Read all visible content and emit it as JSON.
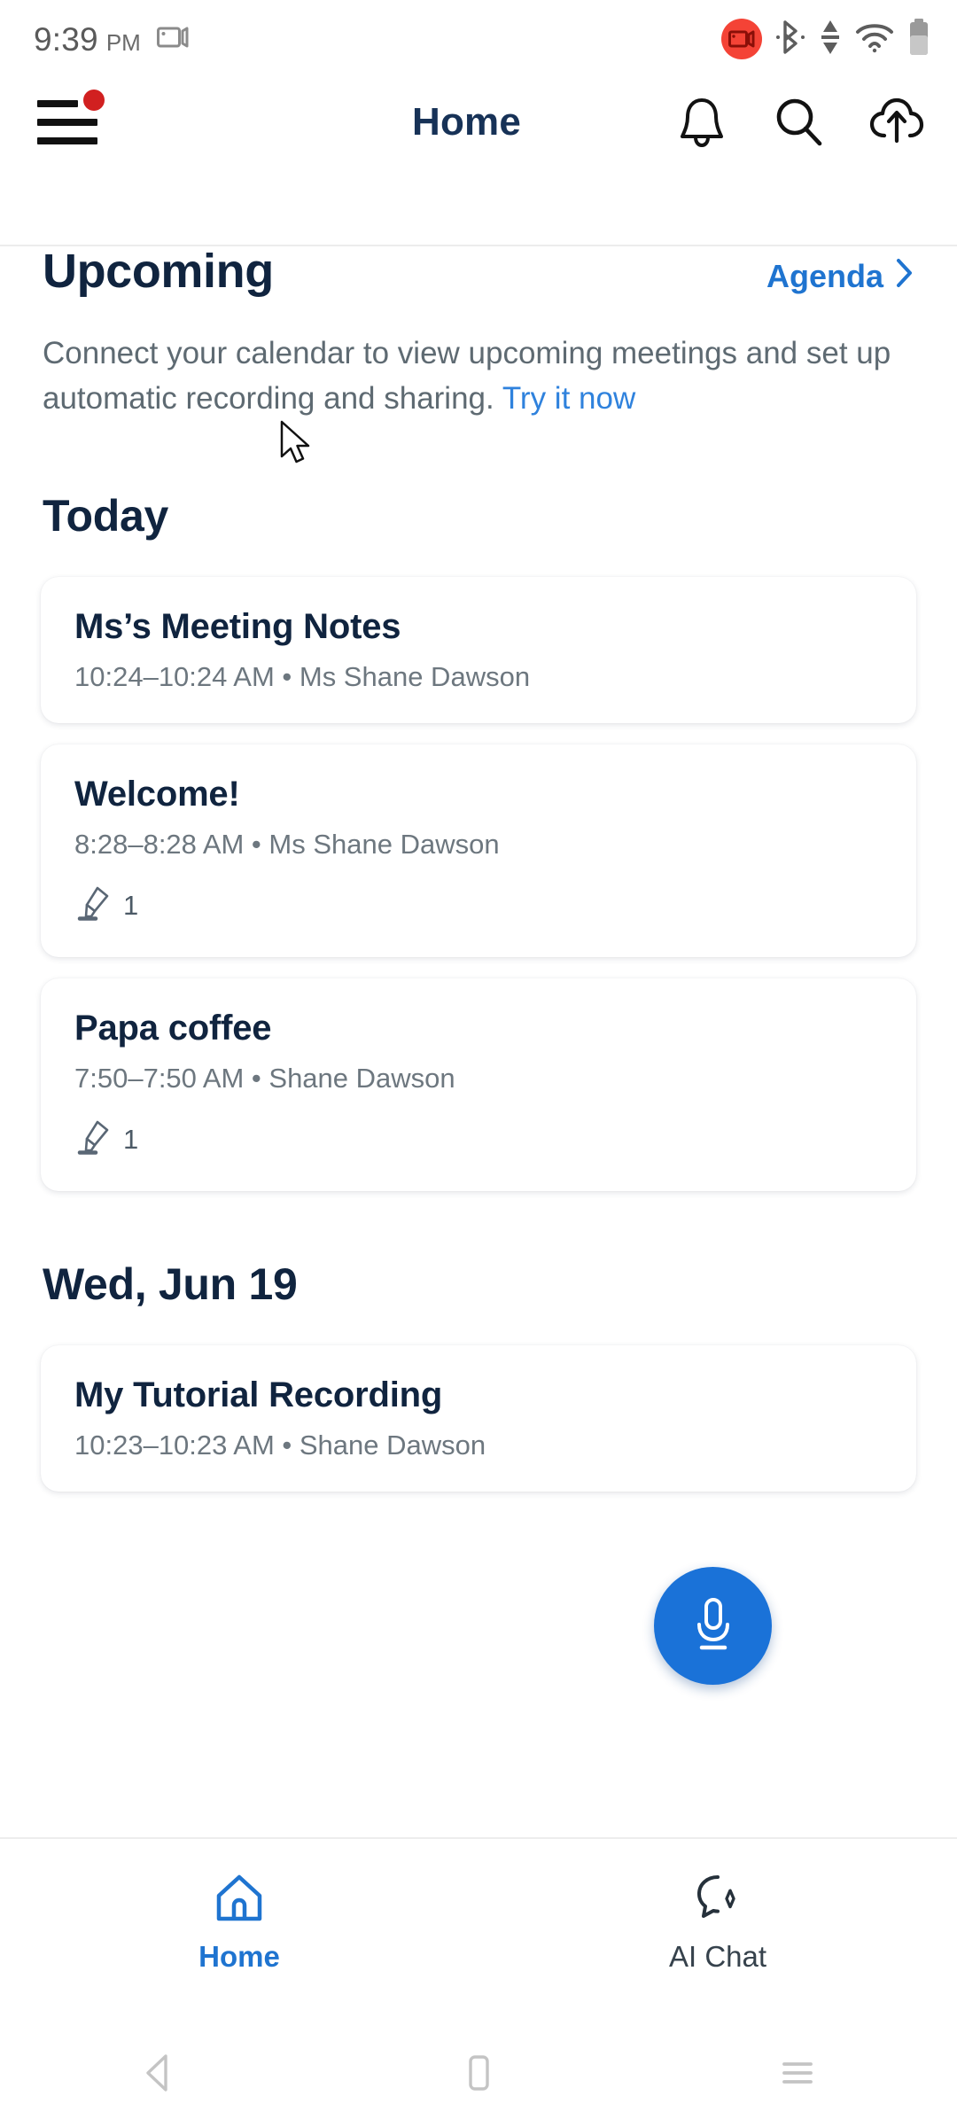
{
  "statusbar": {
    "time": "9:39",
    "ampm": "PM",
    "icons": [
      "screen-record-icon",
      "recording-badge-icon",
      "bluetooth-icon",
      "data-transfer-icon",
      "wifi-icon",
      "battery-icon"
    ]
  },
  "appbar": {
    "title": "Home",
    "menu_icon": "hamburger-menu-icon",
    "has_notification_dot": true,
    "icons": [
      "bell-icon",
      "search-icon",
      "cloud-upload-icon"
    ]
  },
  "upcoming": {
    "title": "Upcoming",
    "agenda_label": "Agenda",
    "description_before": "Connect your calendar to view upcoming meetings and set up automatic recording and sharing. ",
    "description_link": "Try it now"
  },
  "today": {
    "title": "Today",
    "cards": [
      {
        "title": "Ms’s Meeting Notes",
        "subtitle": "10:24–10:24 AM •  Ms Shane Dawson",
        "meta_count": null
      },
      {
        "title": "Welcome!",
        "subtitle": "8:28–8:28 AM •  Ms Shane Dawson",
        "meta_count": "1"
      },
      {
        "title": "Papa coffee",
        "subtitle": "7:50–7:50 AM •  Shane Dawson",
        "meta_count": "1"
      }
    ]
  },
  "next_day": {
    "title": "Wed, Jun 19",
    "cards": [
      {
        "title": "My Tutorial Recording",
        "subtitle": "10:23–10:23 AM •  Shane Dawson"
      }
    ]
  },
  "fab": {
    "icon": "microphone-icon",
    "color": "#1a72d8"
  },
  "bottomnav": {
    "items": [
      {
        "label": "Home",
        "icon": "home-icon",
        "active": true
      },
      {
        "label": "AI Chat",
        "icon": "ai-chat-icon",
        "active": false
      }
    ]
  },
  "androidnav": {
    "items": [
      "back-icon",
      "home-square-icon",
      "recents-icon"
    ]
  },
  "colors": {
    "accent_blue": "#1f74d0",
    "title_navy": "#10243f",
    "muted_gray": "#6d777f",
    "notification_red": "#d12020"
  }
}
